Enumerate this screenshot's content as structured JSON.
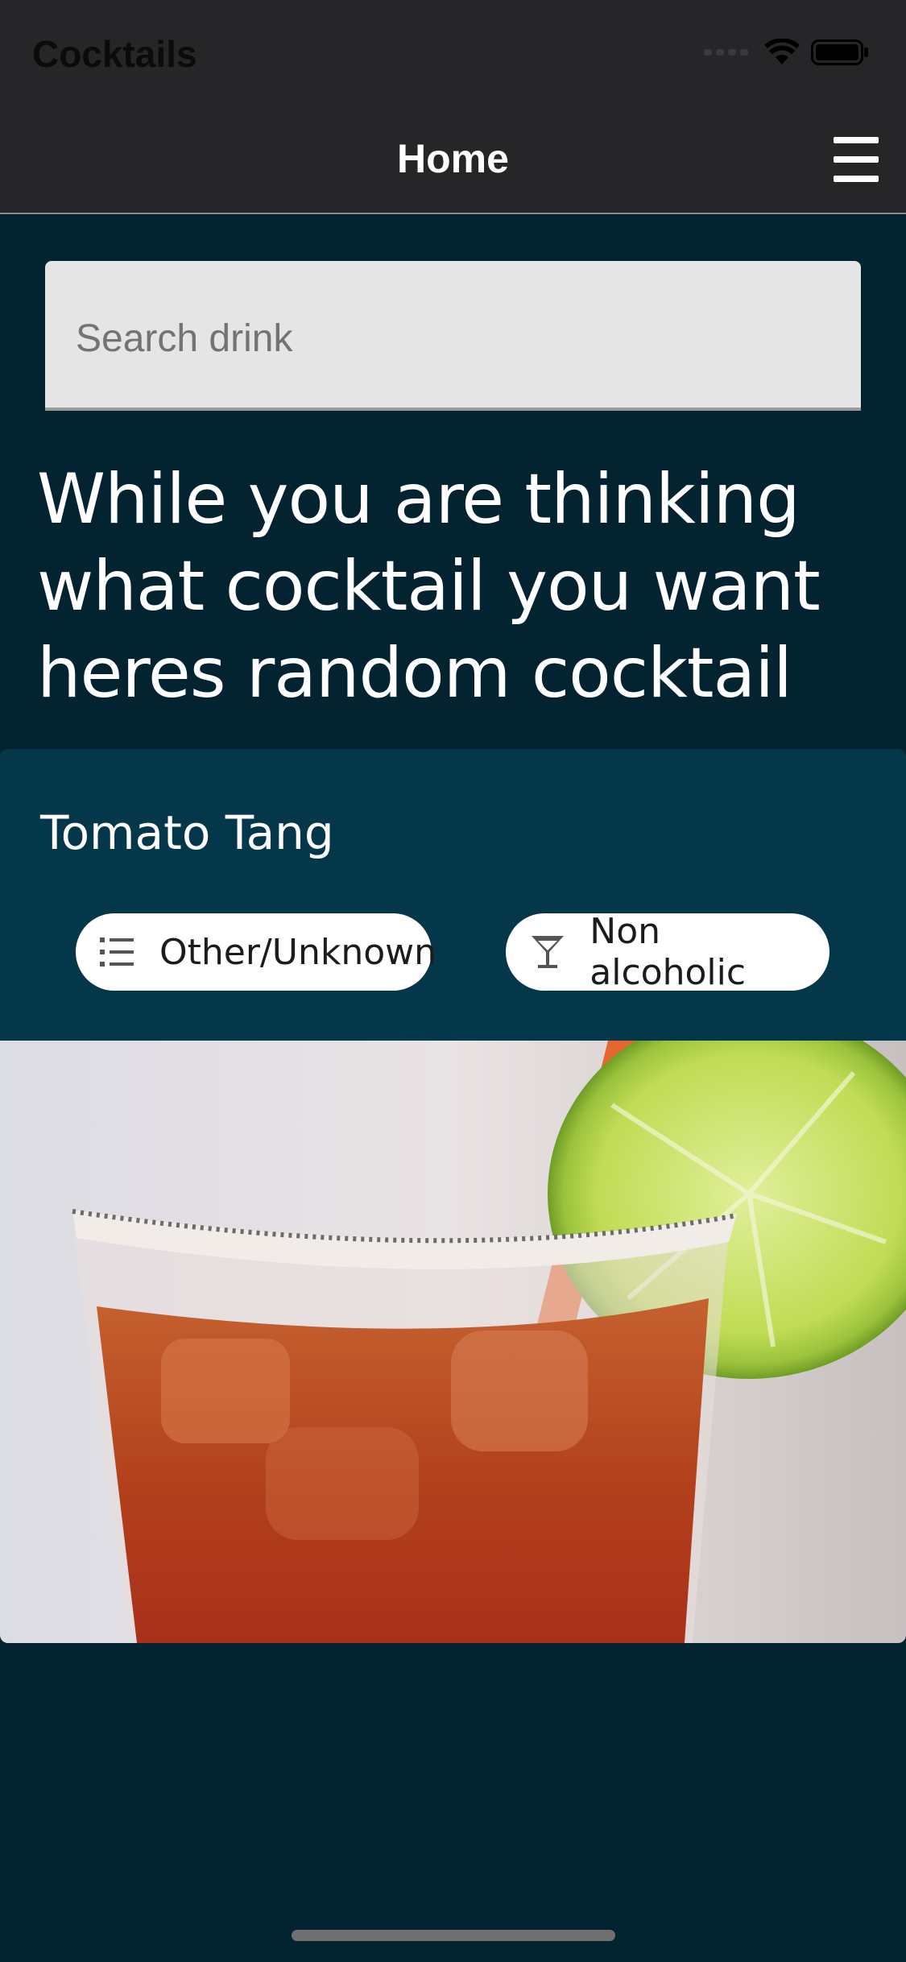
{
  "status_bar": {
    "app_name": "Cocktails"
  },
  "nav": {
    "title": "Home",
    "menu_icon": "hamburger-menu-icon"
  },
  "search": {
    "placeholder": "Search drink",
    "value": ""
  },
  "intro": {
    "text": "While you are thinking what cocktail you want heres random cocktail"
  },
  "random_cocktail": {
    "name": "Tomato Tang",
    "category": "Other/Unknown",
    "category_icon": "list-icon",
    "alcoholic": "Non alcoholic",
    "alcoholic_icon": "cocktail-glass-icon",
    "image_icon": "drink-photo"
  },
  "colors": {
    "background": "#032330",
    "card": "#043749",
    "bar": "#262628",
    "chip": "#ffffff"
  }
}
